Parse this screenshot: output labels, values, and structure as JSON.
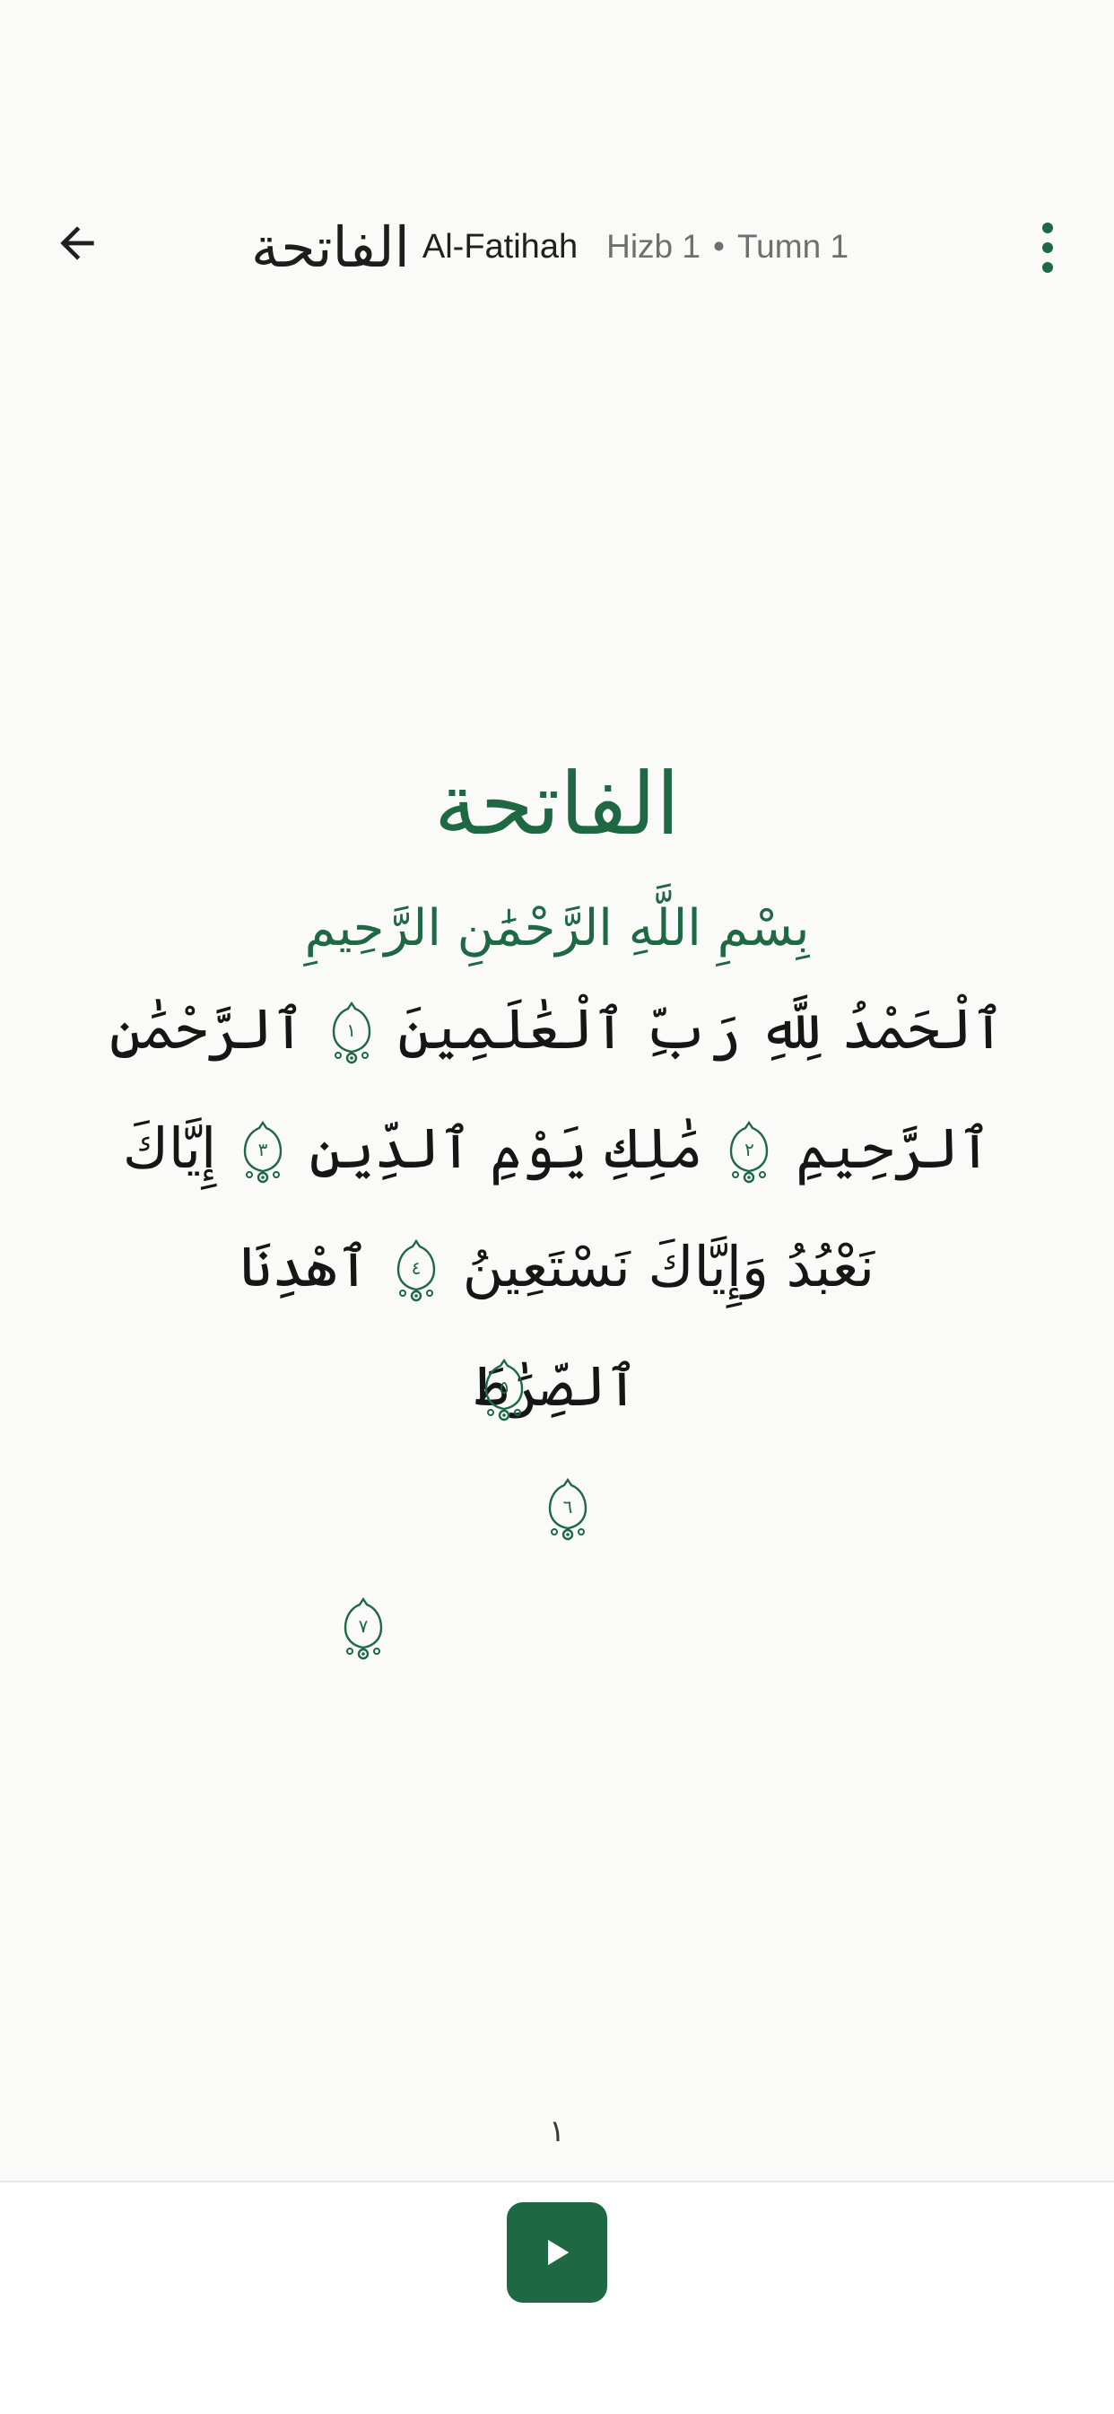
{
  "header": {
    "surah_name_arabic": "الفاتحة",
    "surah_name": "Al-Fatihah",
    "hizb": "Hizb 1",
    "separator": "•",
    "tumn": "Tumn 1",
    "back_icon": "arrow-left-icon",
    "menu_icon": "more-vert-icon"
  },
  "mushaf": {
    "surah_heading": "الفاتحة",
    "basmala": "بِسْمِ اللَّهِ الرَّحْمَٰنِ الرَّحِيمِ",
    "line_1": {
      "part_a": "ٱلْحَمْدُ لِلَّهِ رَبِّ ٱلْعَٰلَمِينَ",
      "part_b": "ٱلرَّحْمَٰنِ"
    },
    "line_2": {
      "part_a": "ٱلرَّحِيمِ",
      "part_b": "مَٰلِكِ يَوْمِ ٱلدِّينِ",
      "part_c": "إِيَّاكَ"
    },
    "line_3": {
      "part_a": "نَعْبُدُ وَإِيَّاكَ نَسْتَعِينُ",
      "part_b": "ٱهْدِنَا"
    },
    "line_4": {
      "part_a": "ٱلصِّرَٰطَ"
    },
    "ayah_numbers": [
      "١",
      "٢",
      "٣",
      "٤",
      "٥",
      "٦",
      "٧"
    ]
  },
  "page_number": "١",
  "player": {
    "play_icon": "play-icon"
  },
  "colors": {
    "accent": "#1e6844",
    "background": "#fafaf9",
    "text": "#161616"
  }
}
